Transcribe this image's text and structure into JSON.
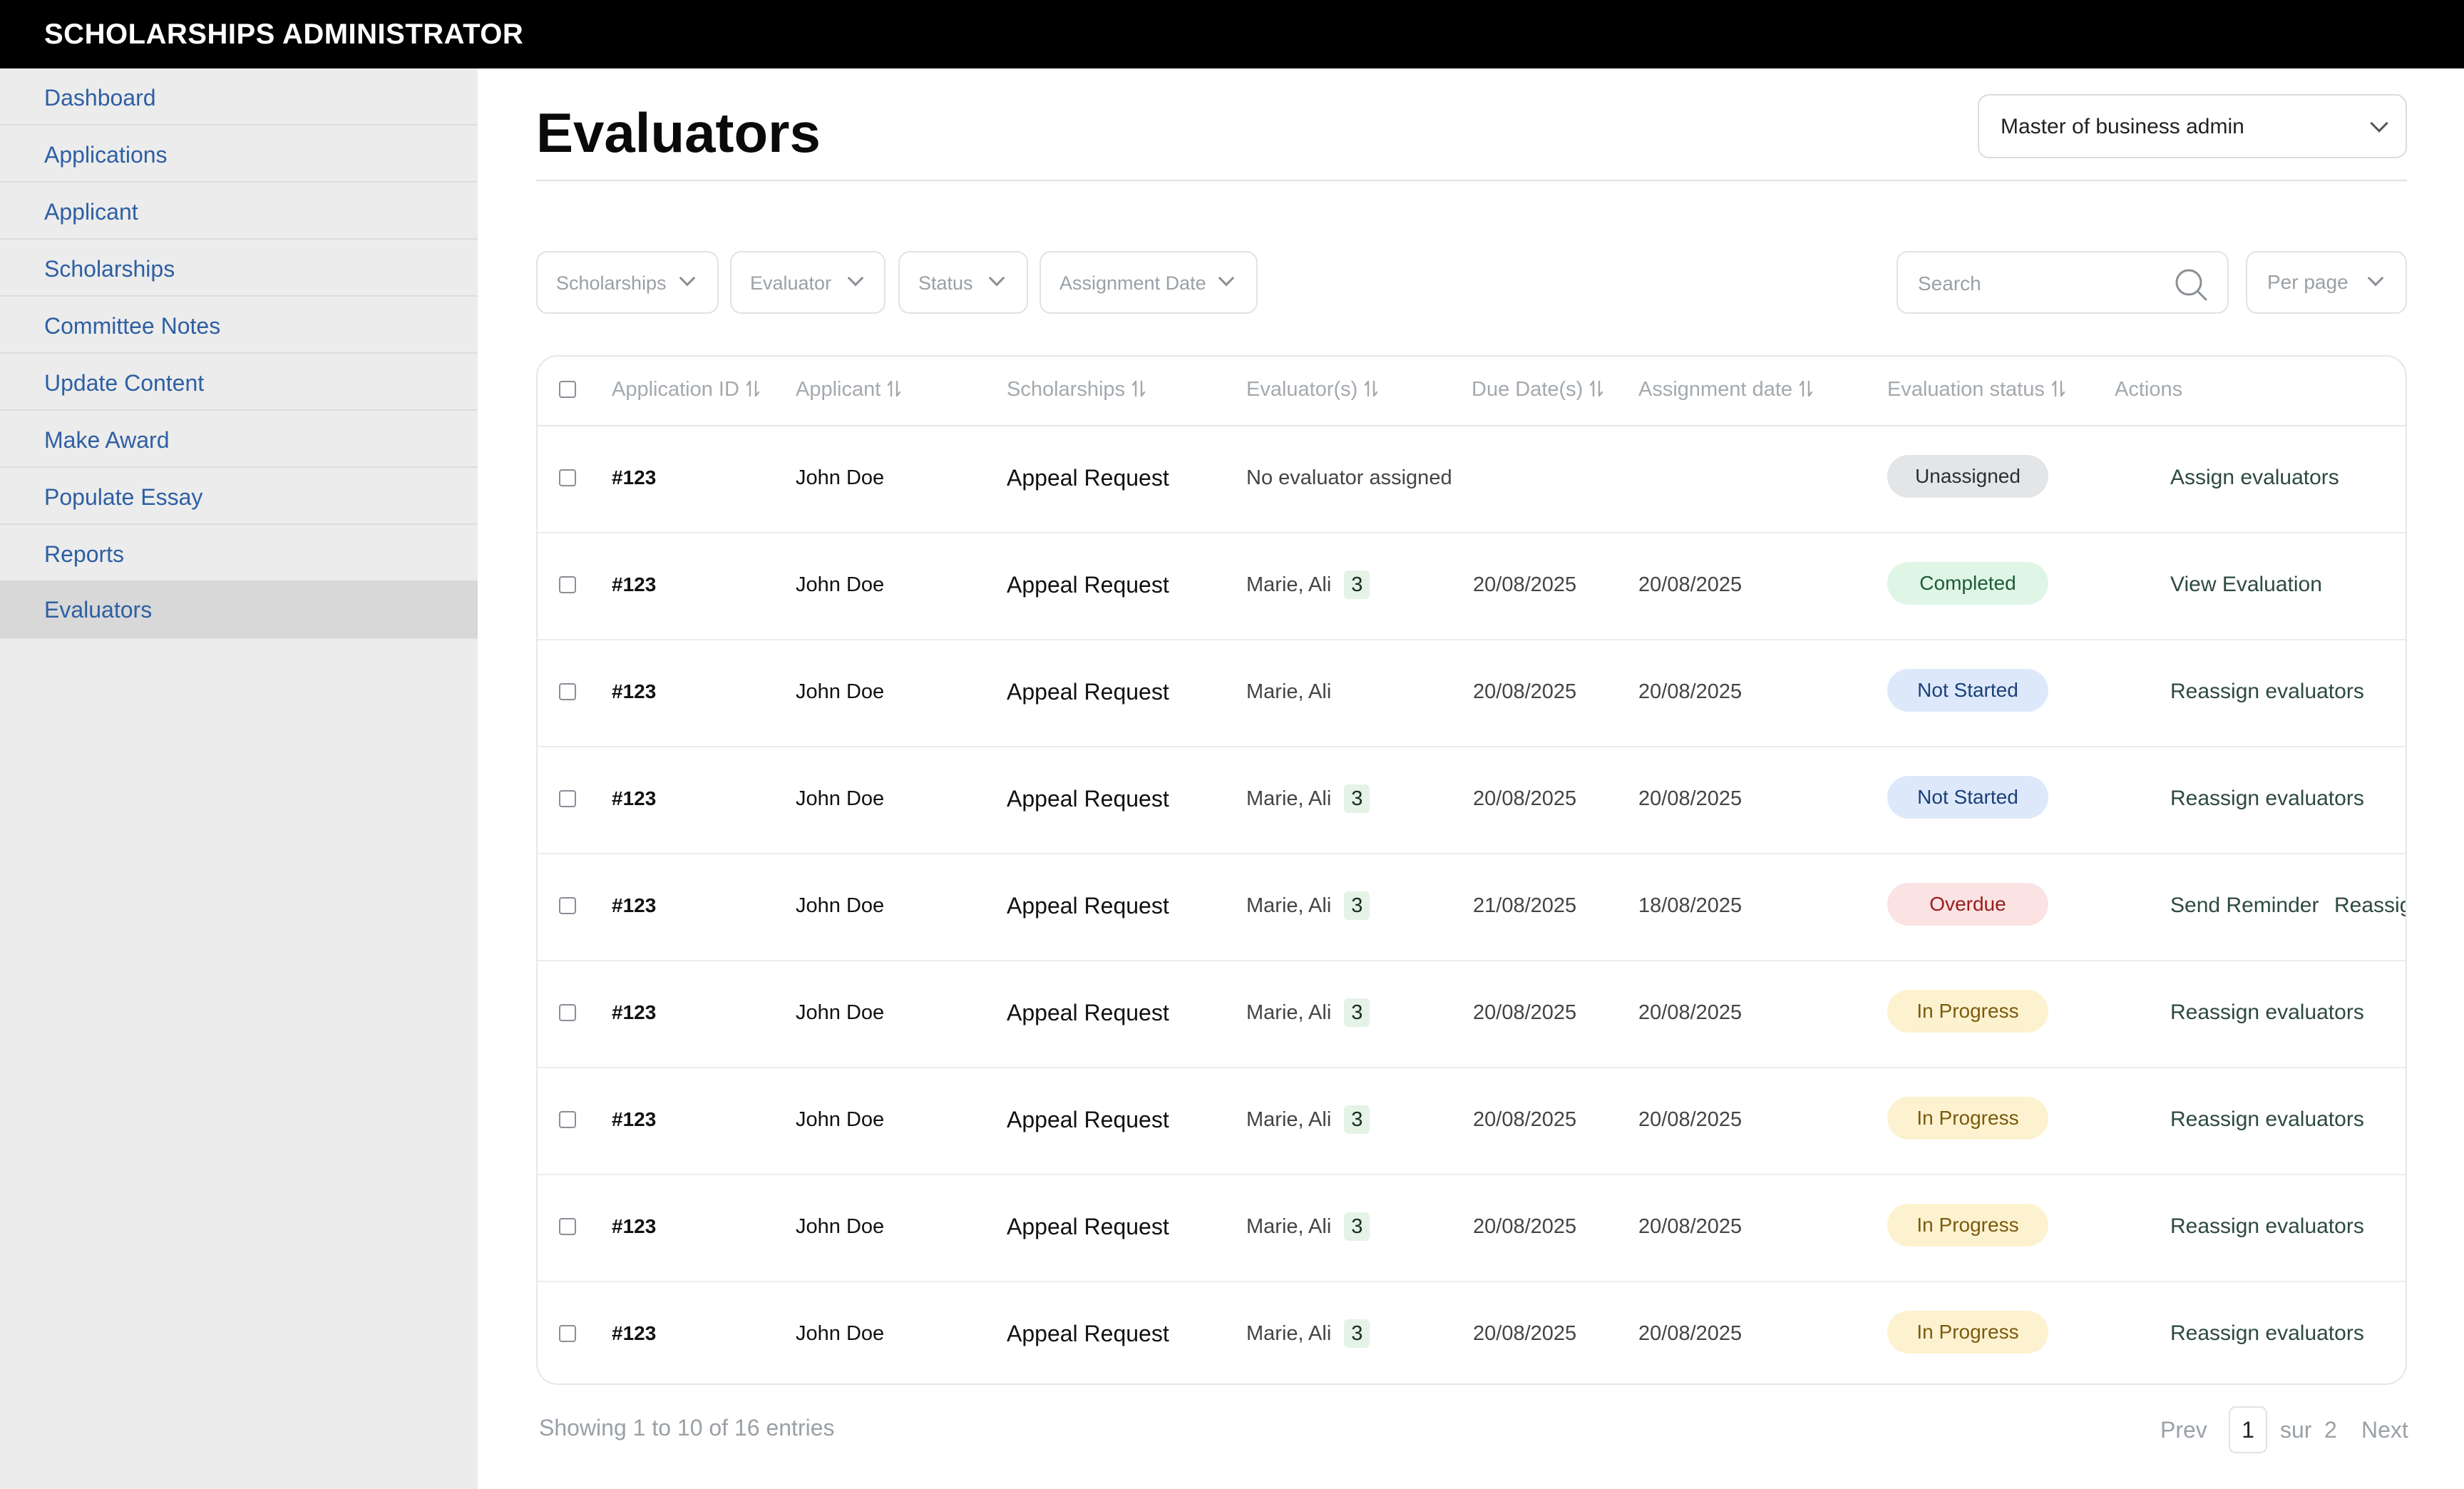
{
  "app": {
    "brand": "SCHOLARSHIPS ADMINISTRATOR"
  },
  "sidebar": {
    "items": [
      {
        "label": "Dashboard"
      },
      {
        "label": "Applications"
      },
      {
        "label": "Applicant"
      },
      {
        "label": "Scholarships"
      },
      {
        "label": "Committee Notes"
      },
      {
        "label": "Update Content"
      },
      {
        "label": "Make Award"
      },
      {
        "label": "Populate Essay"
      },
      {
        "label": "Reports"
      },
      {
        "label": "Evaluators"
      }
    ],
    "active": "Evaluators"
  },
  "header": {
    "title": "Evaluators",
    "program_select": {
      "value": "Master of business admin"
    }
  },
  "filters": {
    "scholarships": "Scholarships",
    "evaluator": "Evaluator",
    "status": "Status",
    "assignment_date": "Assignment Date",
    "search_placeholder": "Search",
    "per_page": "Per page"
  },
  "table": {
    "columns": {
      "application_id": "Application ID",
      "applicant": "Applicant",
      "scholarships": "Scholarships",
      "evaluators": "Evaluator(s)",
      "due_dates": "Due Date(s)",
      "assignment_date": "Assignment date",
      "evaluation_status": "Evaluation status",
      "actions": "Actions"
    },
    "rows": [
      {
        "id": "#123",
        "applicant": "John Doe",
        "scholarship": "Appeal Request",
        "evaluators": "No evaluator assigned",
        "count": "",
        "due": "",
        "assigned": "",
        "status": "Unassigned",
        "status_key": "unassigned",
        "action": "Assign evaluators",
        "action2": ""
      },
      {
        "id": "#123",
        "applicant": "John Doe",
        "scholarship": "Appeal Request",
        "evaluators": "Marie, Ali",
        "count": "3",
        "due": "20/08/2025",
        "assigned": "20/08/2025",
        "status": "Completed",
        "status_key": "completed",
        "action": "View Evaluation",
        "action2": ""
      },
      {
        "id": "#123",
        "applicant": "John Doe",
        "scholarship": "Appeal Request",
        "evaluators": "Marie, Ali",
        "count": "",
        "due": "20/08/2025",
        "assigned": "20/08/2025",
        "status": "Not Started",
        "status_key": "notstarted",
        "action": "Reassign evaluators",
        "action2": ""
      },
      {
        "id": "#123",
        "applicant": "John Doe",
        "scholarship": "Appeal Request",
        "evaluators": "Marie, Ali",
        "count": "3",
        "due": "20/08/2025",
        "assigned": "20/08/2025",
        "status": "Not Started",
        "status_key": "notstarted",
        "action": "Reassign evaluators",
        "action2": ""
      },
      {
        "id": "#123",
        "applicant": "John Doe",
        "scholarship": "Appeal Request",
        "evaluators": "Marie, Ali",
        "count": "3",
        "due": "21/08/2025",
        "assigned": "18/08/2025",
        "status": "Overdue",
        "status_key": "overdue",
        "action": "Send Reminder",
        "action2": "Reassign"
      },
      {
        "id": "#123",
        "applicant": "John Doe",
        "scholarship": "Appeal Request",
        "evaluators": "Marie, Ali",
        "count": "3",
        "due": "20/08/2025",
        "assigned": "20/08/2025",
        "status": "In Progress",
        "status_key": "inprogress",
        "action": "Reassign evaluators",
        "action2": ""
      },
      {
        "id": "#123",
        "applicant": "John Doe",
        "scholarship": "Appeal Request",
        "evaluators": "Marie, Ali",
        "count": "3",
        "due": "20/08/2025",
        "assigned": "20/08/2025",
        "status": "In Progress",
        "status_key": "inprogress",
        "action": "Reassign evaluators",
        "action2": ""
      },
      {
        "id": "#123",
        "applicant": "John Doe",
        "scholarship": "Appeal Request",
        "evaluators": "Marie, Ali",
        "count": "3",
        "due": "20/08/2025",
        "assigned": "20/08/2025",
        "status": "In Progress",
        "status_key": "inprogress",
        "action": "Reassign evaluators",
        "action2": ""
      },
      {
        "id": "#123",
        "applicant": "John Doe",
        "scholarship": "Appeal Request",
        "evaluators": "Marie, Ali",
        "count": "3",
        "due": "20/08/2025",
        "assigned": "20/08/2025",
        "status": "In Progress",
        "status_key": "inprogress",
        "action": "Reassign evaluators",
        "action2": ""
      }
    ]
  },
  "footer": {
    "showing": "Showing 1 to 10 of 16 entries",
    "prev": "Prev",
    "current_page": "1",
    "of_label": "sur",
    "total_pages": "2",
    "next": "Next"
  },
  "colors": {
    "accent_link": "#2e5fa3",
    "status_unassigned": "#e4e5e7",
    "status_completed": "#dff6e6",
    "status_notstarted": "#dde9fb",
    "status_overdue": "#fbe3e3",
    "status_inprogress": "#fdf2cf"
  },
  "icons": {
    "search": "search-icon",
    "chevron": "chevron-down-icon",
    "sort": "sort-icon"
  }
}
